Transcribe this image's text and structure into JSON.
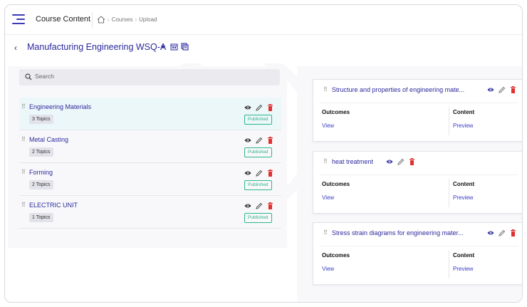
{
  "header": {
    "app_title": "Course Content",
    "breadcrumbs": [
      "Courses",
      "Upload"
    ]
  },
  "course": {
    "title": "Manufacturing Engineering WSQ-A"
  },
  "search": {
    "placeholder": "Search",
    "value": ""
  },
  "modules": [
    {
      "name": "Engineering Materials",
      "topics": "3 Topics",
      "status": "Published"
    },
    {
      "name": "Metal Casting",
      "topics": "2 Topics",
      "status": "Published"
    },
    {
      "name": "Forming",
      "topics": "2 Topics",
      "status": "Published"
    },
    {
      "name": "ELECTRIC UNIT",
      "topics": "1 Topics",
      "status": "Published"
    }
  ],
  "topics": [
    {
      "title": "Structure and properties of engineering mate...",
      "outcomes_label": "Outcomes",
      "content_label": "Content",
      "outcomes_link": "View",
      "content_link": "Preview"
    },
    {
      "title": "heat treatment",
      "outcomes_label": "Outcomes",
      "content_label": "Content",
      "outcomes_link": "View",
      "content_link": "Preview"
    },
    {
      "title": "Stress strain diagrams for engineering mater...",
      "outcomes_label": "Outcomes",
      "content_label": "Content",
      "outcomes_link": "View",
      "content_link": "Preview"
    }
  ],
  "colors": {
    "brand": "#2c2a9e",
    "published": "#2fb58b",
    "delete": "#e03131",
    "active_row": "#ecf7f9"
  }
}
